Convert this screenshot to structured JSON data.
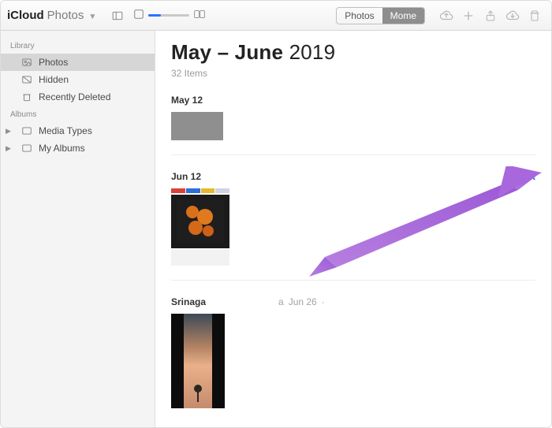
{
  "toolbar": {
    "title_main": "iCloud",
    "title_sub": "Photos",
    "view_tab_photos": "Photos",
    "view_tab_moments": "Mome"
  },
  "sidebar": {
    "section_library": "Library",
    "section_albums": "Albums",
    "photos": "Photos",
    "hidden": "Hidden",
    "recently_deleted": "Recently Deleted",
    "media_types": "Media Types",
    "my_albums": "My Albums"
  },
  "main": {
    "heading_range": "May – June",
    "heading_year": "2019",
    "item_count": "32 Items",
    "sections": [
      {
        "label": "May 12"
      },
      {
        "label": "Jun 12",
        "select": "Select"
      },
      {
        "label": "Srinaga",
        "mid_a": "a",
        "date": "Jun 26",
        "dot": "·"
      }
    ]
  }
}
